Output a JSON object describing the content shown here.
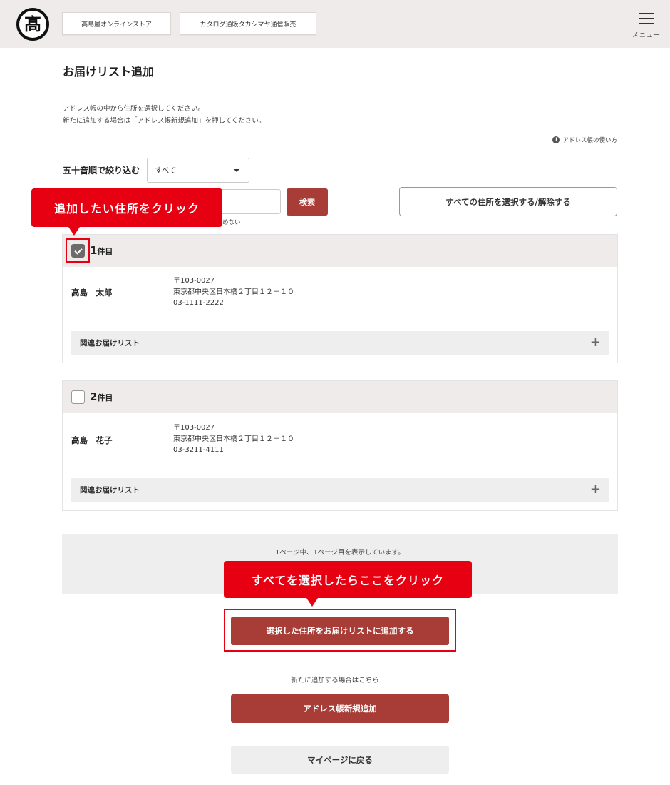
{
  "header": {
    "logo_glyph": "髙",
    "store_button": "高島屋オンラインストア",
    "catalog_button": "カタログ通販タカシマヤ通信販売",
    "menu_label": "メニュー"
  },
  "page": {
    "title": "お届けリスト追加",
    "description_line1": "アドレス帳の中から住所を選択してください。",
    "description_line2": "新たに追加する場合は「アドレス帳新規追加」を押してください。",
    "help_icon": "i",
    "help_link": "アドレス帳の使い方"
  },
  "filter": {
    "label": "五十音順で絞り込む",
    "selected": "すべて",
    "search_value": "",
    "search_button": "検索",
    "search_note": "めない",
    "select_all_button": "すべての住所を選択する/解除する"
  },
  "callouts": {
    "click_address": "追加したい住所をクリック",
    "after_select": "すべてを選択したらここをクリック"
  },
  "addresses": [
    {
      "index_num": "1",
      "index_suffix": "件目",
      "checked": true,
      "name": "高島　太郎",
      "postal": "〒103-0027",
      "address": "東京都中央区日本橋２丁目１２－１０",
      "phone": "03-1111-2222",
      "related_label": "関連お届けリスト",
      "expand_symbol": "+"
    },
    {
      "index_num": "2",
      "index_suffix": "件目",
      "checked": false,
      "name": "高島　花子",
      "postal": "〒103-0027",
      "address": "東京都中央区日本橋２丁目１２－１０",
      "phone": "03-3211-4111",
      "related_label": "関連お届けリスト",
      "expand_symbol": "+"
    }
  ],
  "paging": {
    "text": "1ページ中、1ページ目を表示しています。"
  },
  "actions": {
    "add_to_list": "選択した住所をお届けリストに追加する",
    "new_note": "新たに追加する場合はこちら",
    "new_address": "アドレス帳新規追加",
    "back": "マイページに戻る"
  },
  "colors": {
    "accent": "#a83c36",
    "callout": "#e60012",
    "header_bg": "#efebea"
  }
}
